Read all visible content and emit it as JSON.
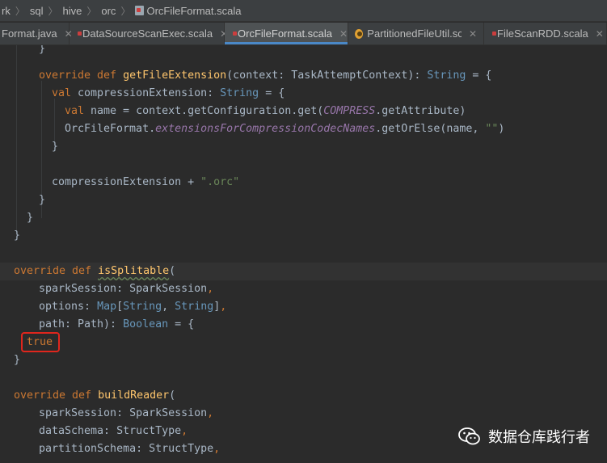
{
  "breadcrumb": {
    "items": [
      "rk",
      "sql",
      "hive",
      "orc"
    ],
    "file": "OrcFileFormat.scala"
  },
  "tabs": [
    {
      "label": "Format.java",
      "icon": "java-file-icon",
      "active": false,
      "closable": true
    },
    {
      "label": "DataSourceScanExec.scala",
      "icon": "scala-file-icon",
      "active": false,
      "closable": true
    },
    {
      "label": "OrcFileFormat.scala",
      "icon": "scala-file-icon",
      "active": true,
      "closable": true
    },
    {
      "label": "PartitionedFileUtil.scala",
      "icon": "scala-object-icon",
      "active": false,
      "closable": true
    },
    {
      "label": "FileScanRDD.scala",
      "icon": "scala-file-icon",
      "active": false,
      "closable": true
    }
  ],
  "code": {
    "l1": "}",
    "l2_kw": "override def ",
    "l2_fn": "getFileExtension",
    "l2_rest": "(context: TaskAttemptContext): ",
    "l2_type": "String",
    "l2_end": " = {",
    "l3_kw": "val ",
    "l3_rest": "compressionExtension: ",
    "l3_type": "String",
    "l3_end": " = {",
    "l4_kw": "val ",
    "l4_rest": "name = context.getConfiguration.get(",
    "l4_it": "COMPRESS",
    "l4_end": ".getAttribute)",
    "l5_a": "OrcFileFormat.",
    "l5_it": "extensionsForCompressionCodecNames",
    "l5_b": ".getOrElse(name, ",
    "l5_str": "\"\"",
    "l5_end": ")",
    "l6": "}",
    "l7_a": "compressionExtension + ",
    "l7_str": "\".orc\"",
    "l8": "}",
    "l9": "}",
    "l10": "}",
    "l11_kw": "override def ",
    "l11_fn": "isSplitable",
    "l11_end": "(",
    "l12_a": "sparkSession: SparkSession",
    "l12_end": ",",
    "l13_a": "options: ",
    "l13_t1": "Map",
    "l13_b": "[",
    "l13_t2": "String",
    "l13_c": ", ",
    "l13_t3": "String",
    "l13_d": "]",
    "l13_end": ",",
    "l14_a": "path: Path): ",
    "l14_type": "Boolean",
    "l14_end": " = {",
    "l15_kw": "true",
    "l16": "}",
    "l17_kw": "override def ",
    "l17_fn": "buildReader",
    "l17_end": "(",
    "l18_a": "sparkSession: SparkSession",
    "l18_end": ",",
    "l19_a": "dataSchema: StructType",
    "l19_end": ",",
    "l20_a": "partitionSchema: StructType",
    "l20_end": ","
  },
  "watermark": {
    "text": "数据仓库践行者",
    "icon": "wechat-icon"
  },
  "colors": {
    "keyword": "#cc7832",
    "function": "#ffc66d",
    "type": "#6897bb",
    "string": "#6a8759",
    "italic_field": "#9876aa",
    "highlight_box": "#e0261d",
    "editor_bg": "#2b2b2b"
  }
}
